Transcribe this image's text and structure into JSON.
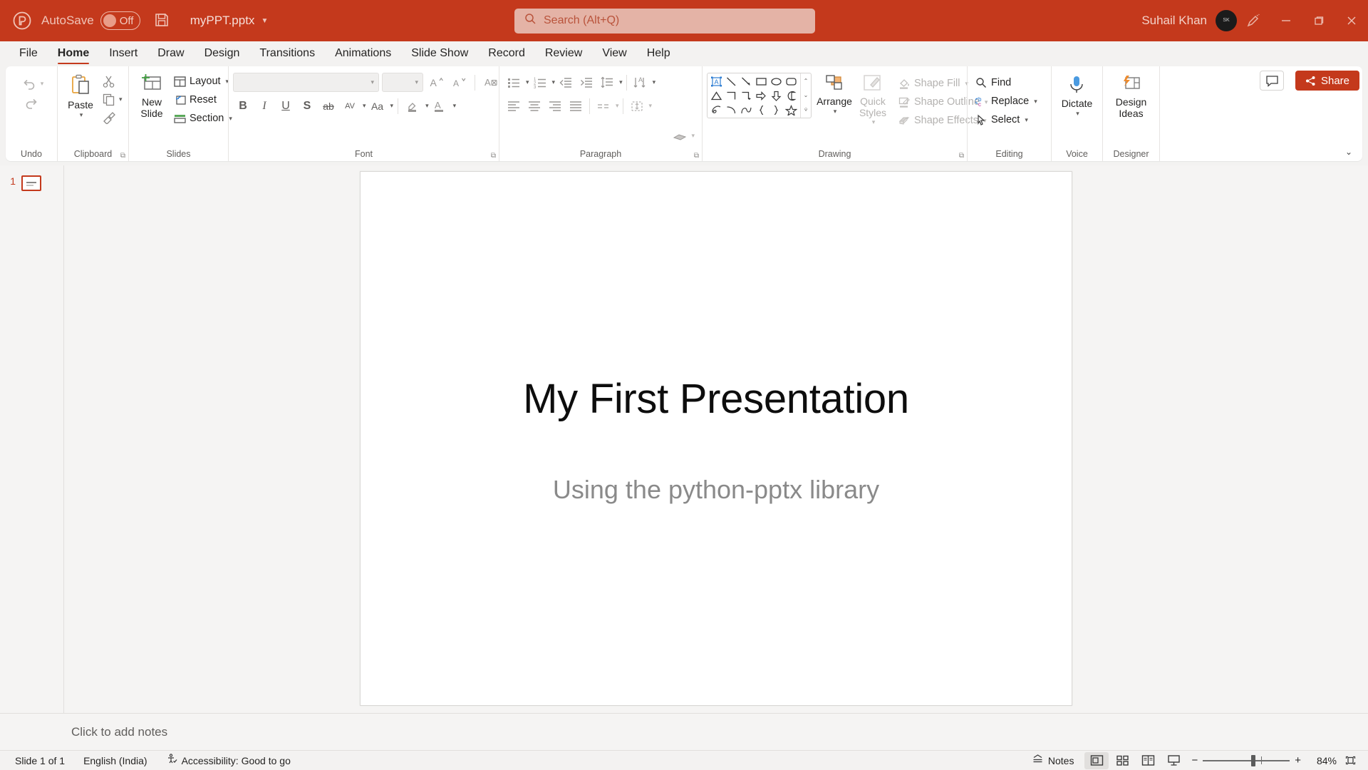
{
  "titlebar": {
    "app_icon": "powerpoint-logo-icon",
    "autosave_label": "AutoSave",
    "autosave_state": "Off",
    "save_icon": "save-icon",
    "document_title": "myPPT.pptx",
    "username": "Suhail Khan",
    "avatar_initials": "SK",
    "window_buttons": [
      "minimize",
      "restore",
      "close"
    ],
    "ink_icon": "pen-ink-icon",
    "accent_color": "#c4391c"
  },
  "search": {
    "placeholder": "Search (Alt+Q)",
    "icon": "search-icon"
  },
  "tabs": [
    {
      "label": "File",
      "active": false
    },
    {
      "label": "Home",
      "active": true
    },
    {
      "label": "Insert",
      "active": false
    },
    {
      "label": "Draw",
      "active": false
    },
    {
      "label": "Design",
      "active": false
    },
    {
      "label": "Transitions",
      "active": false
    },
    {
      "label": "Animations",
      "active": false
    },
    {
      "label": "Slide Show",
      "active": false
    },
    {
      "label": "Record",
      "active": false
    },
    {
      "label": "Review",
      "active": false
    },
    {
      "label": "View",
      "active": false
    },
    {
      "label": "Help",
      "active": false
    }
  ],
  "ribbon": {
    "comment_button": "Comments",
    "share_button": "Share",
    "collapse_icon": "chevron-up-icon",
    "groups": {
      "undo": {
        "label": "Undo",
        "undo_icon": "undo-arrow-icon",
        "redo_icon": "redo-arrow-icon"
      },
      "clipboard": {
        "label": "Clipboard",
        "paste_label": "Paste",
        "cut_icon": "scissors-icon",
        "copy_icon": "copy-icon",
        "format_painter_icon": "format-painter-icon"
      },
      "slides": {
        "label": "Slides",
        "new_slide_label": "New Slide",
        "layout_label": "Layout",
        "reset_label": "Reset",
        "section_label": "Section"
      },
      "font": {
        "label": "Font",
        "font_name_value": "",
        "font_size_value": "",
        "grow_font_icon": "grow-font-icon",
        "shrink_font_icon": "shrink-font-icon",
        "clear_formatting_icon": "clear-formatting-icon",
        "bold": "B",
        "italic": "I",
        "underline": "U",
        "shadow": "S",
        "strikethrough": "ab",
        "char_spacing": "AV",
        "change_case": "Aa",
        "text_highlight_icon": "text-highlight-icon",
        "font_color_icon": "font-color-icon"
      },
      "paragraph": {
        "label": "Paragraph",
        "bullets_icon": "bullets-icon",
        "numbering_icon": "numbering-icon",
        "decrease_indent_icon": "decrease-indent-icon",
        "increase_indent_icon": "increase-indent-icon",
        "line_spacing_icon": "line-spacing-icon",
        "align_left_icon": "align-left-icon",
        "align_center_icon": "align-center-icon",
        "align_right_icon": "align-right-icon",
        "justify_icon": "justify-icon",
        "columns_icon": "columns-icon",
        "text_direction_icon": "text-direction-icon",
        "align_text_icon": "align-text-icon",
        "convert_smartart_icon": "smartart-icon"
      },
      "drawing": {
        "label": "Drawing",
        "arrange_label": "Arrange",
        "quick_styles_label": "Quick Styles",
        "shape_fill_label": "Shape Fill",
        "shape_outline_label": "Shape Outline",
        "shape_effects_label": "Shape Effects",
        "shapes": [
          "text-box-icon",
          "line-icon",
          "arrow-icon",
          "rectangle-icon",
          "oval-icon",
          "rounded-rectangle-icon",
          "triangle-icon",
          "elbow-connector-icon",
          "elbow-arrow-connector-icon",
          "right-arrow-icon",
          "down-arrow-icon",
          "pie-shape-icon",
          "scribble-icon",
          "arc-icon",
          "curve-icon",
          "left-brace-icon",
          "right-brace-icon",
          "star-icon"
        ]
      },
      "editing": {
        "label": "Editing",
        "find_label": "Find",
        "replace_label": "Replace",
        "select_label": "Select"
      },
      "voice": {
        "label": "Voice",
        "dictate_label": "Dictate",
        "icon": "microphone-icon"
      },
      "designer": {
        "label": "Designer",
        "design_ideas_label": "Design Ideas",
        "icon": "design-ideas-icon"
      }
    }
  },
  "thumbnails": [
    {
      "number": "1",
      "selected": true
    }
  ],
  "slide": {
    "title": "My First Presentation",
    "subtitle": "Using the python-pptx library",
    "title_color": "#0d0d0d",
    "subtitle_color": "#8a8a8a"
  },
  "notes": {
    "placeholder": "Click to add notes"
  },
  "statusbar": {
    "slide_counter": "Slide 1 of 1",
    "language": "English (India)",
    "accessibility": "Accessibility: Good to go",
    "accessibility_icon": "accessibility-icon",
    "notes_label": "Notes",
    "notes_icon": "notes-icon",
    "views": [
      {
        "name": "normal-view",
        "icon": "normal-view-icon",
        "selected": true
      },
      {
        "name": "slide-sorter-view",
        "icon": "slide-sorter-icon",
        "selected": false
      },
      {
        "name": "reading-view",
        "icon": "reading-view-icon",
        "selected": false
      },
      {
        "name": "slide-show-view",
        "icon": "slide-show-icon",
        "selected": false
      }
    ],
    "zoom_out": "−",
    "zoom_in": "+",
    "zoom_level": "84%",
    "fit_icon": "fit-to-window-icon"
  }
}
